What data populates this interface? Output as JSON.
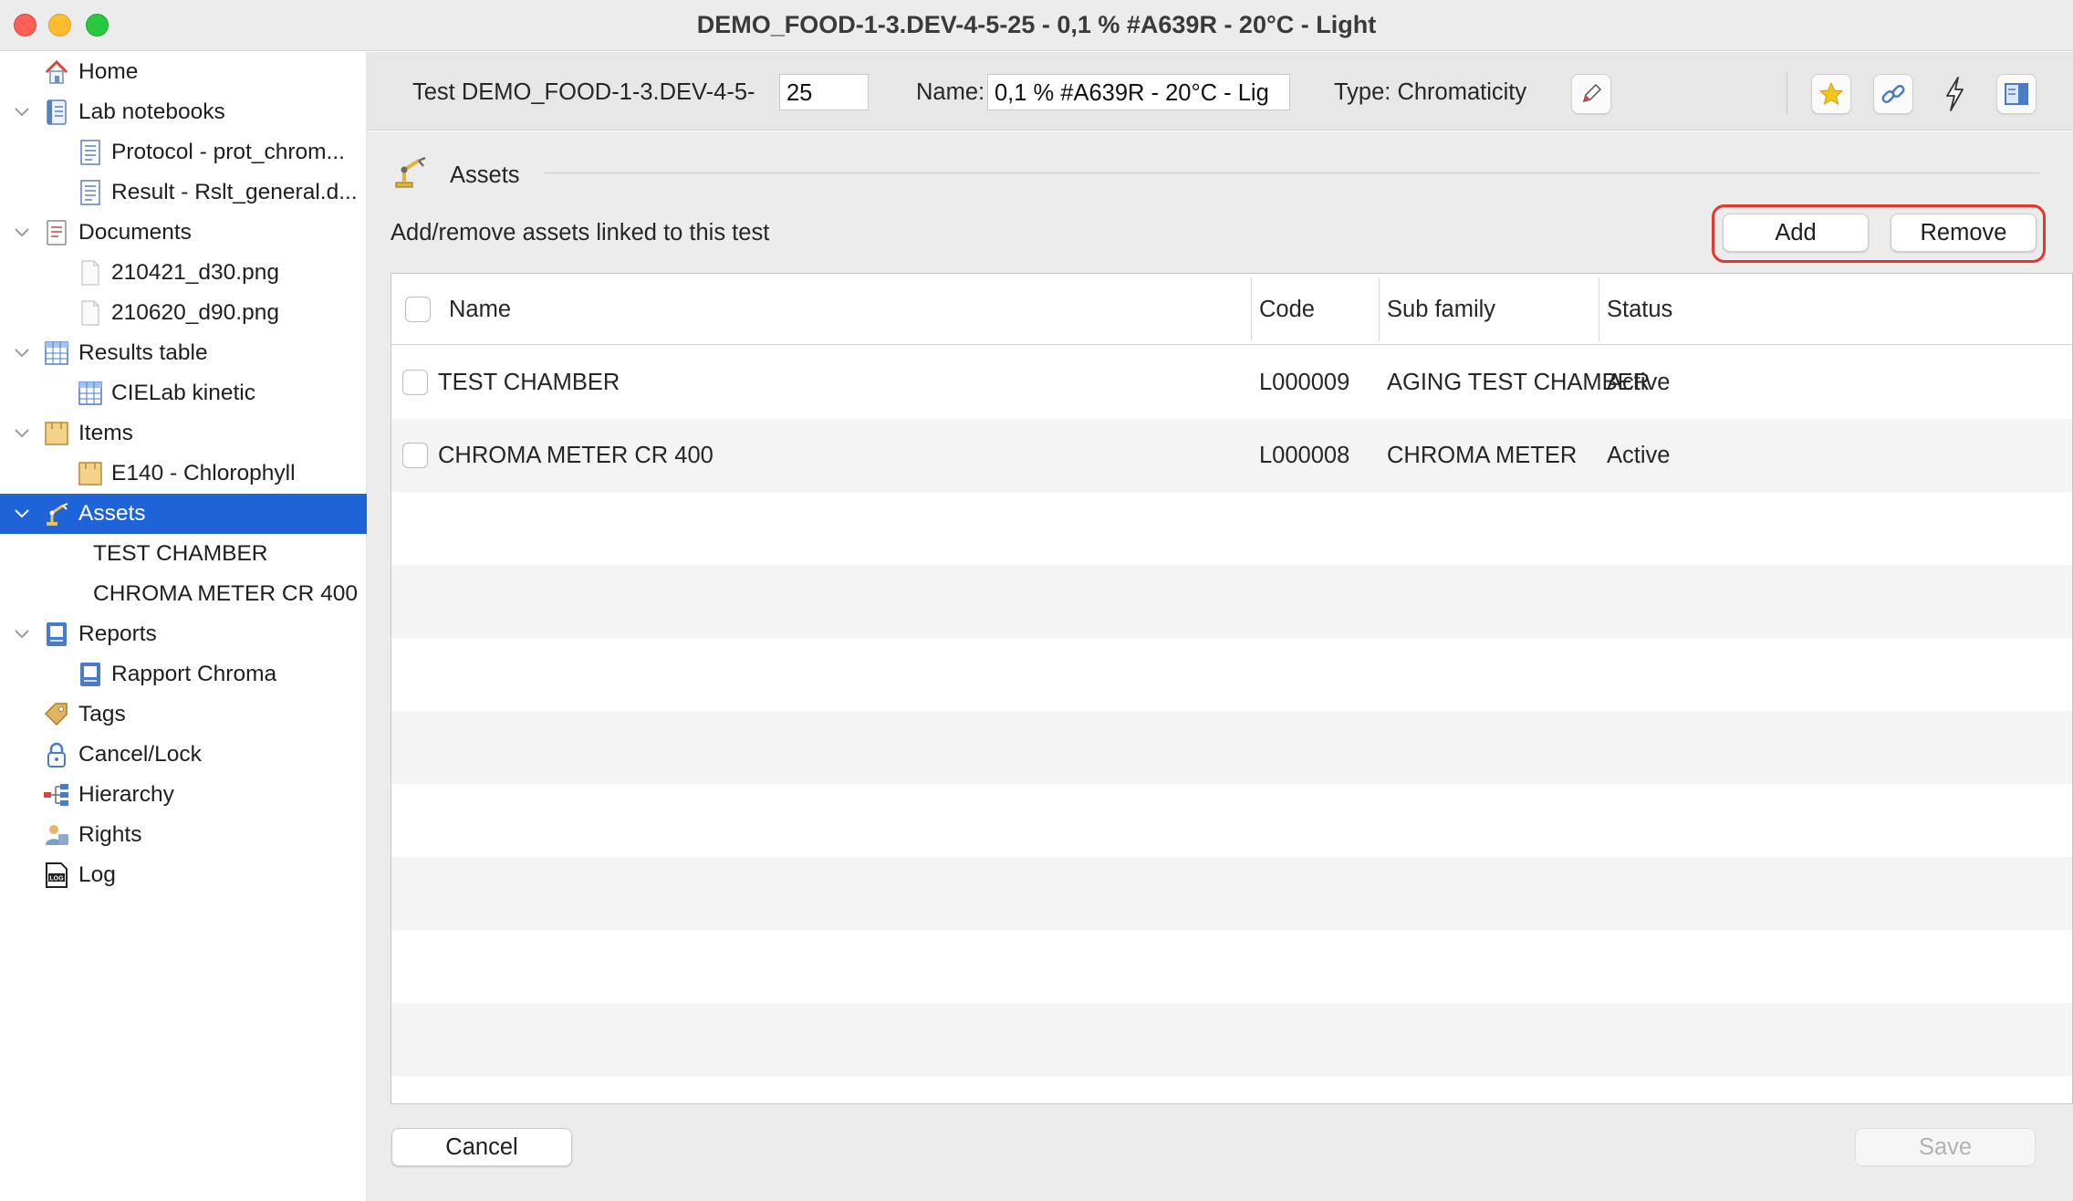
{
  "window": {
    "title": "DEMO_FOOD-1-3.DEV-4-5-25 - 0,1 % #A639R - 20°C - Light"
  },
  "sidebar": {
    "items": [
      {
        "label": "Home",
        "icon": "house-icon"
      },
      {
        "label": "Lab notebooks",
        "icon": "notebook-icon"
      },
      {
        "label": "Protocol - prot_chrom...",
        "icon": "document-icon"
      },
      {
        "label": "Result - Rslt_general.d...",
        "icon": "document-icon"
      },
      {
        "label": "Documents",
        "icon": "documents-icon"
      },
      {
        "label": "210421_d30.png",
        "icon": "file-icon"
      },
      {
        "label": "210620_d90.png",
        "icon": "file-icon"
      },
      {
        "label": "Results table",
        "icon": "table-icon"
      },
      {
        "label": "CIELab kinetic",
        "icon": "table-icon"
      },
      {
        "label": "Items",
        "icon": "box-icon"
      },
      {
        "label": "E140 - Chlorophyll",
        "icon": "box-icon"
      },
      {
        "label": "Assets",
        "icon": "robot-arm-icon"
      },
      {
        "label": "TEST CHAMBER",
        "icon": ""
      },
      {
        "label": "CHROMA METER CR 400",
        "icon": ""
      },
      {
        "label": "Reports",
        "icon": "report-icon"
      },
      {
        "label": "Rapport Chroma",
        "icon": "report-icon"
      },
      {
        "label": "Tags",
        "icon": "tag-icon"
      },
      {
        "label": "Cancel/Lock",
        "icon": "lock-icon"
      },
      {
        "label": "Hierarchy",
        "icon": "hierarchy-icon"
      },
      {
        "label": "Rights",
        "icon": "rights-icon"
      },
      {
        "label": "Log",
        "icon": "log-icon"
      }
    ]
  },
  "header": {
    "test_label": "Test DEMO_FOOD-1-3.DEV-4-5-",
    "test_number": "25",
    "name_label": "Name:",
    "name_value": "0,1 % #A639R - 20°C - Lig",
    "type_label": "Type: Chromaticity"
  },
  "section": {
    "title": "Assets",
    "description": "Add/remove assets linked to this test",
    "add_label": "Add",
    "remove_label": "Remove"
  },
  "table": {
    "columns": [
      "Name",
      "Code",
      "Sub family",
      "Status"
    ],
    "rows": [
      {
        "name": "TEST CHAMBER",
        "code": "L000009",
        "sub_family": "AGING TEST CHAMBER",
        "status": "Active"
      },
      {
        "name": "CHROMA METER CR 400",
        "code": "L000008",
        "sub_family": "CHROMA METER",
        "status": "Active"
      }
    ]
  },
  "footer": {
    "cancel_label": "Cancel",
    "save_label": "Save"
  },
  "colors": {
    "selection": "#1f63d8",
    "highlight": "#e8352b",
    "star": "#f5c518"
  }
}
